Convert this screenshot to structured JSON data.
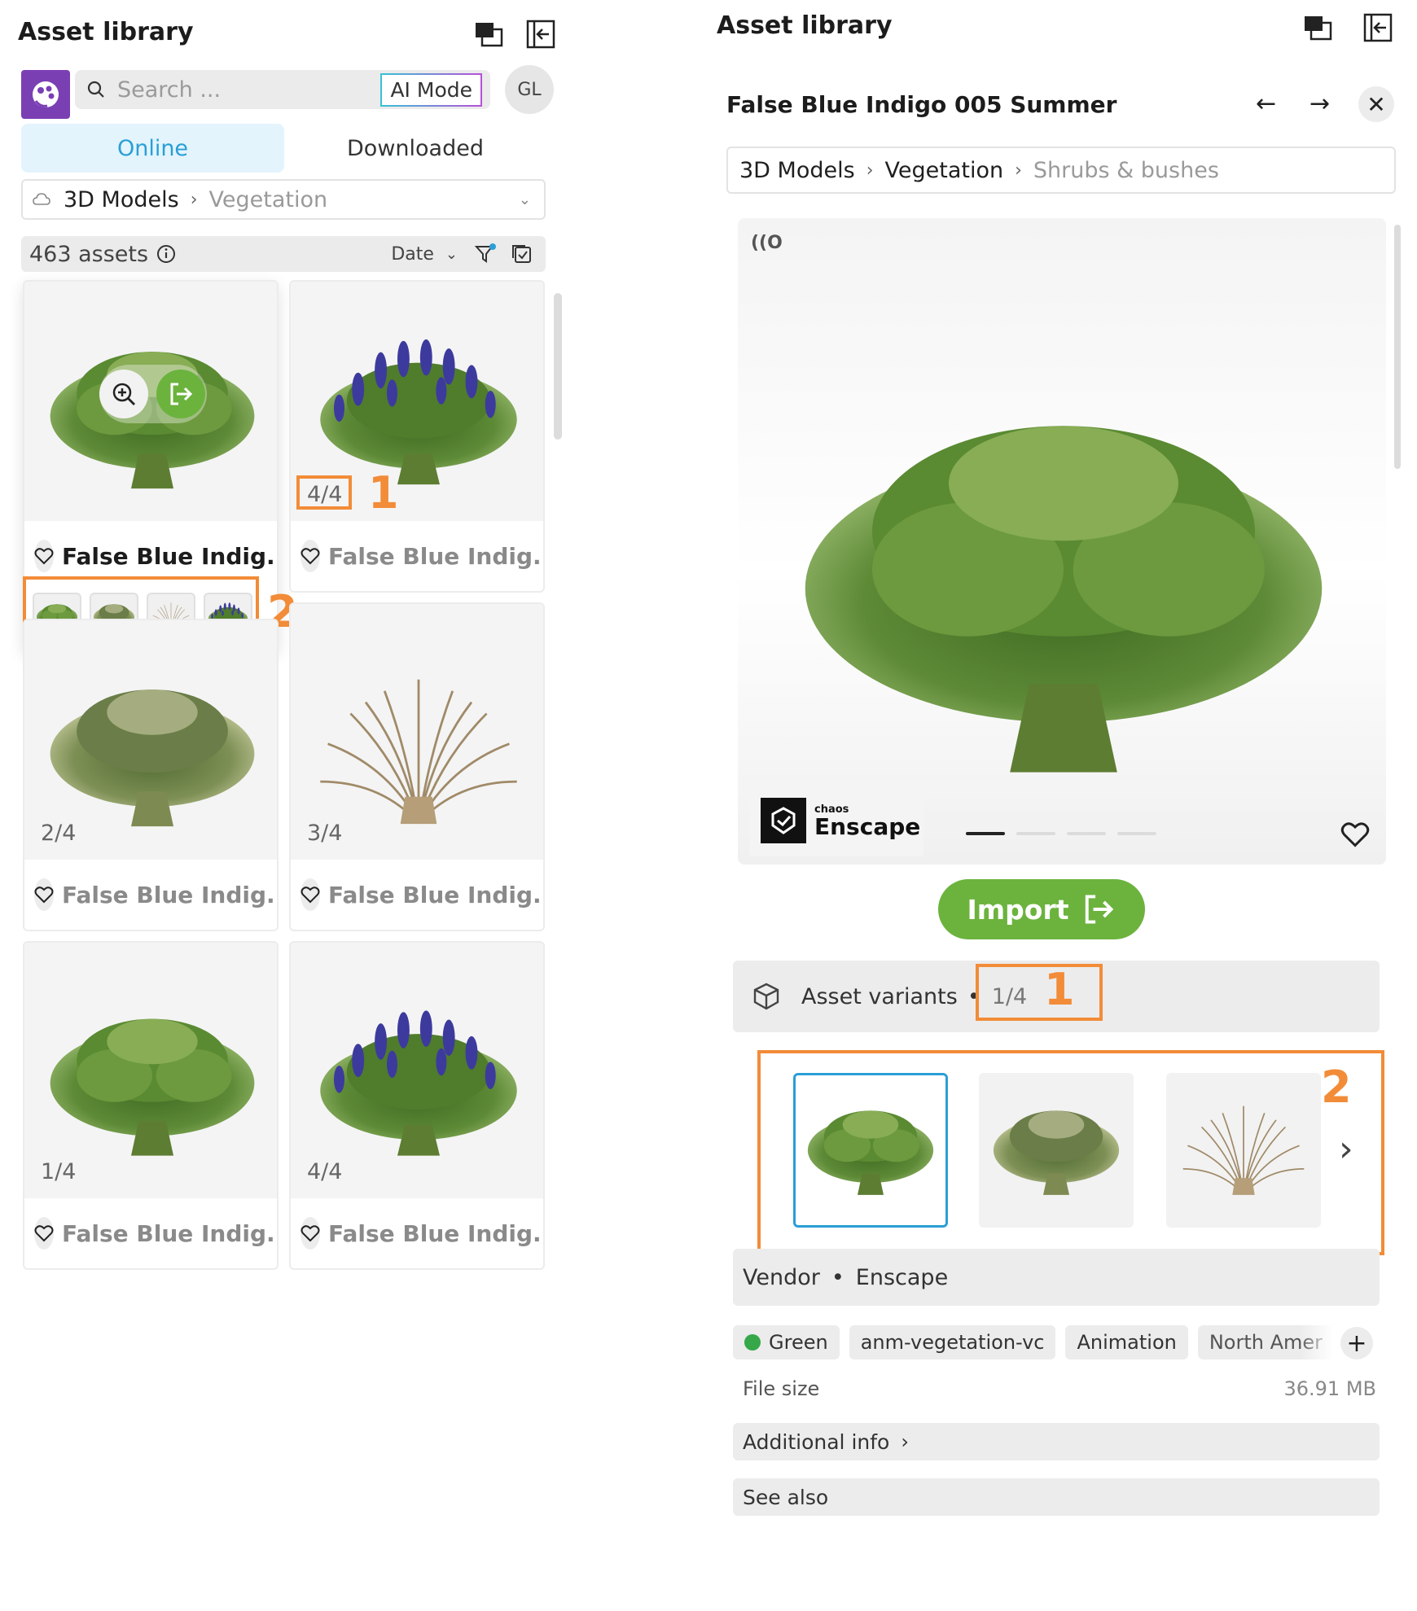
{
  "left": {
    "title": "Asset library",
    "search_placeholder": "Search ...",
    "ai_mode": "AI Mode",
    "avatar": "GL",
    "tabs": [
      "Online",
      "Downloaded"
    ],
    "breadcrumb": [
      "3D Models",
      "Vegetation"
    ],
    "assets_count": "463 assets",
    "sort": "Date",
    "cards": [
      {
        "name": "False Blue Indig...",
        "variant": ""
      },
      {
        "name": "False Blue Indig...",
        "variant": "4/4"
      },
      {
        "name": "False Blue Indig...",
        "variant": "2/4"
      },
      {
        "name": "False Blue Indig...",
        "variant": "3/4"
      },
      {
        "name": "False Blue Indig...",
        "variant": "1/4"
      },
      {
        "name": "False Blue Indig...",
        "variant": "4/4"
      }
    ],
    "callout_1": "1",
    "callout_2": "2"
  },
  "right": {
    "title": "Asset library",
    "asset_title": "False Blue Indigo 005 Summer",
    "breadcrumb": [
      "3D Models",
      "Vegetation",
      "Shrubs & bushes"
    ],
    "brand_small": "chaos",
    "brand_big": "Enscape",
    "import_label": "Import",
    "variants_label": "Asset variants",
    "variants_count": "1/4",
    "callout_1": "1",
    "callout_2": "2",
    "vendor_label": "Vendor",
    "vendor_value": "Enscape",
    "tags": [
      "Green",
      "anm-vegetation-vc",
      "Animation",
      "North Amer"
    ],
    "file_size_label": "File size",
    "file_size_value": "36.91 MB",
    "additional_info": "Additional info",
    "see_also": "See also"
  },
  "colors": {
    "accent_blue": "#2a9fd6",
    "import_green": "#6cb33e",
    "callout_orange": "#f28c38",
    "logo_purple": "#7b3fb4",
    "flower_purple": "#3d3a9e",
    "foliage_green": "#4a7a2a"
  }
}
